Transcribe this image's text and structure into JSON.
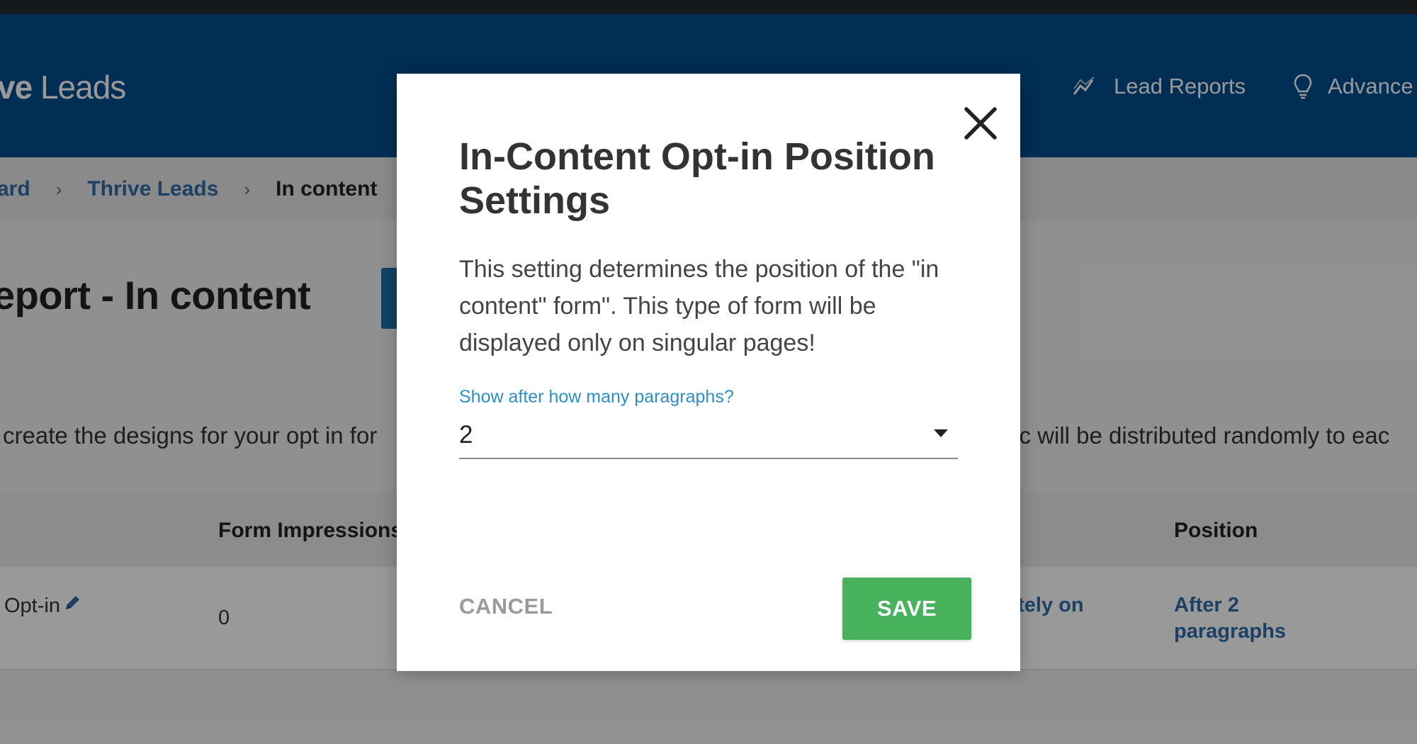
{
  "header": {
    "brand_prefix": "ve",
    "brand_suffix": " Leads",
    "nav": {
      "lead_reports": "Lead Reports",
      "advanced": "Advance"
    }
  },
  "breadcrumb": {
    "dashboard": "ard",
    "thrive_leads": "Thrive Leads",
    "current": "In content",
    "separator": "›"
  },
  "page": {
    "title": "eport - In content",
    "intro_left": "create the designs for your opt in for",
    "intro_right": "fic will be distributed randomly to eac"
  },
  "table": {
    "headers": {
      "impressions": "Form Impressions",
      "position": "Position"
    },
    "rows": [
      {
        "name": "Opt-in",
        "impressions": "0",
        "display": "ately on",
        "position": "After 2 paragraphs"
      }
    ]
  },
  "modal": {
    "title": "In-Content Opt-in Position Settings",
    "description": "This setting determines the position of the \"in content\" form\". This type of form will be displayed only on singular pages!",
    "field_label": "Show after how many paragraphs?",
    "selected_value": "2",
    "cancel_label": "CANCEL",
    "save_label": "SAVE"
  },
  "colors": {
    "header_bg": "#004e8d",
    "link": "#2f6da8",
    "accent_label": "#2e8ec9",
    "save_green": "#47b25b"
  },
  "icons": {
    "close": "close-icon",
    "reports": "trend-chart-icon",
    "advanced": "lightbulb-icon",
    "edit": "pencil-icon",
    "dropdown": "caret-down-icon"
  }
}
